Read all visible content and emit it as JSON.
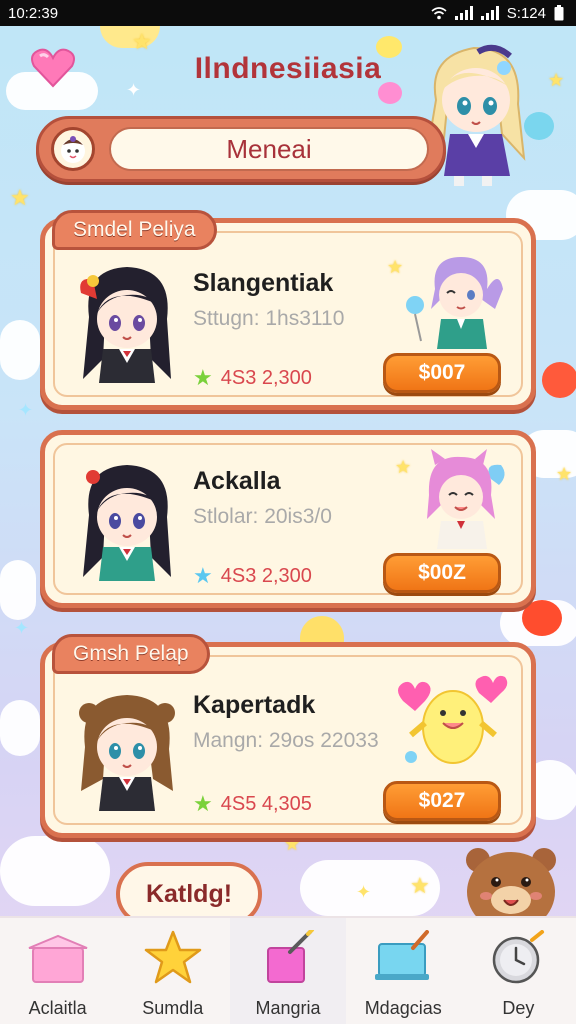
{
  "status_bar": {
    "time": "10:2:39",
    "right_text": "S:124",
    "icons": [
      "wifi-icon",
      "signal-icon",
      "signal-icon",
      "battery-icon"
    ]
  },
  "header": {
    "title": "Ilndnesiiasia",
    "logo_icon": "heart-icon"
  },
  "search": {
    "value": "Meneai",
    "avatar_icon": "chibi-face-icon"
  },
  "sections": [
    {
      "tag": "Smdel Peliya"
    },
    {
      "tag": "Gmsh Pelap"
    }
  ],
  "cards": [
    {
      "name": "Slangentiak",
      "stat": "Sttugn: 1hs3110",
      "price": "4S3 2,300",
      "button": "$007",
      "star_color": "#7ad13b"
    },
    {
      "name": "Ackalla",
      "stat": "Stlolar: 20is3/0",
      "price": "4S3 2,300",
      "button": "$00Z",
      "star_color": "#5ac7f0"
    },
    {
      "name": "Kapertadk",
      "stat": "Mangn: 29os 22033",
      "price": "4S5 4,305",
      "button": "$027",
      "star_color": "#7ad13b"
    }
  ],
  "footer_button": "Katldg!",
  "bottom_nav": [
    {
      "label": "Aclaitla",
      "icon": "gift-box-icon"
    },
    {
      "label": "Sumdla",
      "icon": "star-icon"
    },
    {
      "label": "Mangria",
      "icon": "paint-cup-icon"
    },
    {
      "label": "Mdagcias",
      "icon": "easel-icon"
    },
    {
      "label": "Dey",
      "icon": "clock-icon"
    }
  ],
  "colors": {
    "accent": "#e07b5c",
    "button": "#f07516",
    "title": "#b2343a",
    "price": "#d9474e"
  }
}
